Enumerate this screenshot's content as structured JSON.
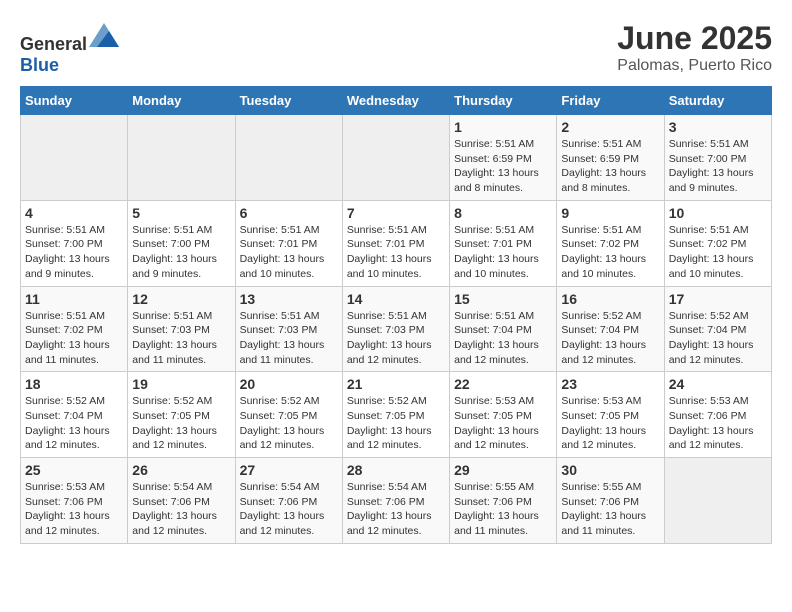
{
  "header": {
    "logo_general": "General",
    "logo_blue": "Blue",
    "title": "June 2025",
    "subtitle": "Palomas, Puerto Rico"
  },
  "calendar": {
    "days_of_week": [
      "Sunday",
      "Monday",
      "Tuesday",
      "Wednesday",
      "Thursday",
      "Friday",
      "Saturday"
    ],
    "weeks": [
      [
        null,
        null,
        null,
        null,
        {
          "day": 1,
          "sunrise": "5:51 AM",
          "sunset": "6:59 PM",
          "daylight": "13 hours and 8 minutes."
        },
        {
          "day": 2,
          "sunrise": "5:51 AM",
          "sunset": "6:59 PM",
          "daylight": "13 hours and 8 minutes."
        },
        {
          "day": 3,
          "sunrise": "5:51 AM",
          "sunset": "7:00 PM",
          "daylight": "13 hours and 9 minutes."
        },
        {
          "day": 4,
          "sunrise": "5:51 AM",
          "sunset": "7:00 PM",
          "daylight": "13 hours and 9 minutes."
        },
        {
          "day": 5,
          "sunrise": "5:51 AM",
          "sunset": "7:00 PM",
          "daylight": "13 hours and 9 minutes."
        },
        {
          "day": 6,
          "sunrise": "5:51 AM",
          "sunset": "7:01 PM",
          "daylight": "13 hours and 10 minutes."
        },
        {
          "day": 7,
          "sunrise": "5:51 AM",
          "sunset": "7:01 PM",
          "daylight": "13 hours and 10 minutes."
        }
      ],
      [
        {
          "day": 8,
          "sunrise": "5:51 AM",
          "sunset": "7:01 PM",
          "daylight": "13 hours and 10 minutes."
        },
        {
          "day": 9,
          "sunrise": "5:51 AM",
          "sunset": "7:02 PM",
          "daylight": "13 hours and 10 minutes."
        },
        {
          "day": 10,
          "sunrise": "5:51 AM",
          "sunset": "7:02 PM",
          "daylight": "13 hours and 10 minutes."
        },
        {
          "day": 11,
          "sunrise": "5:51 AM",
          "sunset": "7:02 PM",
          "daylight": "13 hours and 11 minutes."
        },
        {
          "day": 12,
          "sunrise": "5:51 AM",
          "sunset": "7:03 PM",
          "daylight": "13 hours and 11 minutes."
        },
        {
          "day": 13,
          "sunrise": "5:51 AM",
          "sunset": "7:03 PM",
          "daylight": "13 hours and 11 minutes."
        },
        {
          "day": 14,
          "sunrise": "5:51 AM",
          "sunset": "7:03 PM",
          "daylight": "13 hours and 12 minutes."
        }
      ],
      [
        {
          "day": 15,
          "sunrise": "5:51 AM",
          "sunset": "7:04 PM",
          "daylight": "13 hours and 12 minutes."
        },
        {
          "day": 16,
          "sunrise": "5:52 AM",
          "sunset": "7:04 PM",
          "daylight": "13 hours and 12 minutes."
        },
        {
          "day": 17,
          "sunrise": "5:52 AM",
          "sunset": "7:04 PM",
          "daylight": "13 hours and 12 minutes."
        },
        {
          "day": 18,
          "sunrise": "5:52 AM",
          "sunset": "7:04 PM",
          "daylight": "13 hours and 12 minutes."
        },
        {
          "day": 19,
          "sunrise": "5:52 AM",
          "sunset": "7:05 PM",
          "daylight": "13 hours and 12 minutes."
        },
        {
          "day": 20,
          "sunrise": "5:52 AM",
          "sunset": "7:05 PM",
          "daylight": "13 hours and 12 minutes."
        },
        {
          "day": 21,
          "sunrise": "5:52 AM",
          "sunset": "7:05 PM",
          "daylight": "13 hours and 12 minutes."
        }
      ],
      [
        {
          "day": 22,
          "sunrise": "5:53 AM",
          "sunset": "7:05 PM",
          "daylight": "13 hours and 12 minutes."
        },
        {
          "day": 23,
          "sunrise": "5:53 AM",
          "sunset": "7:05 PM",
          "daylight": "13 hours and 12 minutes."
        },
        {
          "day": 24,
          "sunrise": "5:53 AM",
          "sunset": "7:06 PM",
          "daylight": "13 hours and 12 minutes."
        },
        {
          "day": 25,
          "sunrise": "5:53 AM",
          "sunset": "7:06 PM",
          "daylight": "13 hours and 12 minutes."
        },
        {
          "day": 26,
          "sunrise": "5:54 AM",
          "sunset": "7:06 PM",
          "daylight": "13 hours and 12 minutes."
        },
        {
          "day": 27,
          "sunrise": "5:54 AM",
          "sunset": "7:06 PM",
          "daylight": "13 hours and 12 minutes."
        },
        {
          "day": 28,
          "sunrise": "5:54 AM",
          "sunset": "7:06 PM",
          "daylight": "13 hours and 12 minutes."
        }
      ],
      [
        {
          "day": 29,
          "sunrise": "5:55 AM",
          "sunset": "7:06 PM",
          "daylight": "13 hours and 11 minutes."
        },
        {
          "day": 30,
          "sunrise": "5:55 AM",
          "sunset": "7:06 PM",
          "daylight": "13 hours and 11 minutes."
        },
        null,
        null,
        null,
        null,
        null
      ]
    ]
  }
}
